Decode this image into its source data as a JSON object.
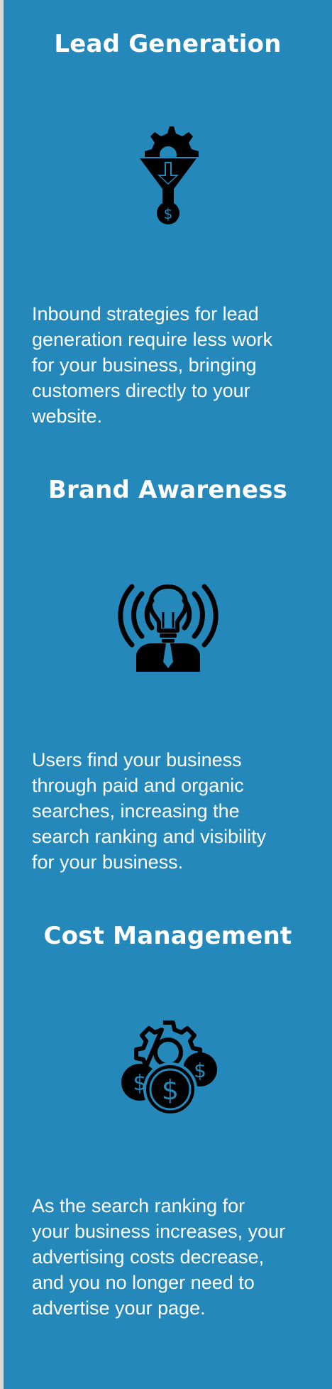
{
  "sections": [
    {
      "title": "Lead Generation",
      "icon": "funnel-gear-dollar-icon",
      "description": "Inbound strategies for lead\ngeneration require less work\nfor your business, bringing\ncustomers directly to your\nwebsite."
    },
    {
      "title": "Brand Awareness",
      "icon": "lightbulb-person-signal-icon",
      "description": "Users find your business\nthrough paid and organic\nsearches, increasing the\nsearch ranking and visibility\nfor your business."
    },
    {
      "title": "Cost Management",
      "icon": "gear-coins-dollar-icon",
      "description": "As the search ranking for\nyour business increases, your\nadvertising costs decrease,\nand you no longer need to\nadvertise your page."
    }
  ],
  "colors": {
    "background": "#2488bb",
    "text": "#ffffff",
    "icon": "#000000"
  }
}
